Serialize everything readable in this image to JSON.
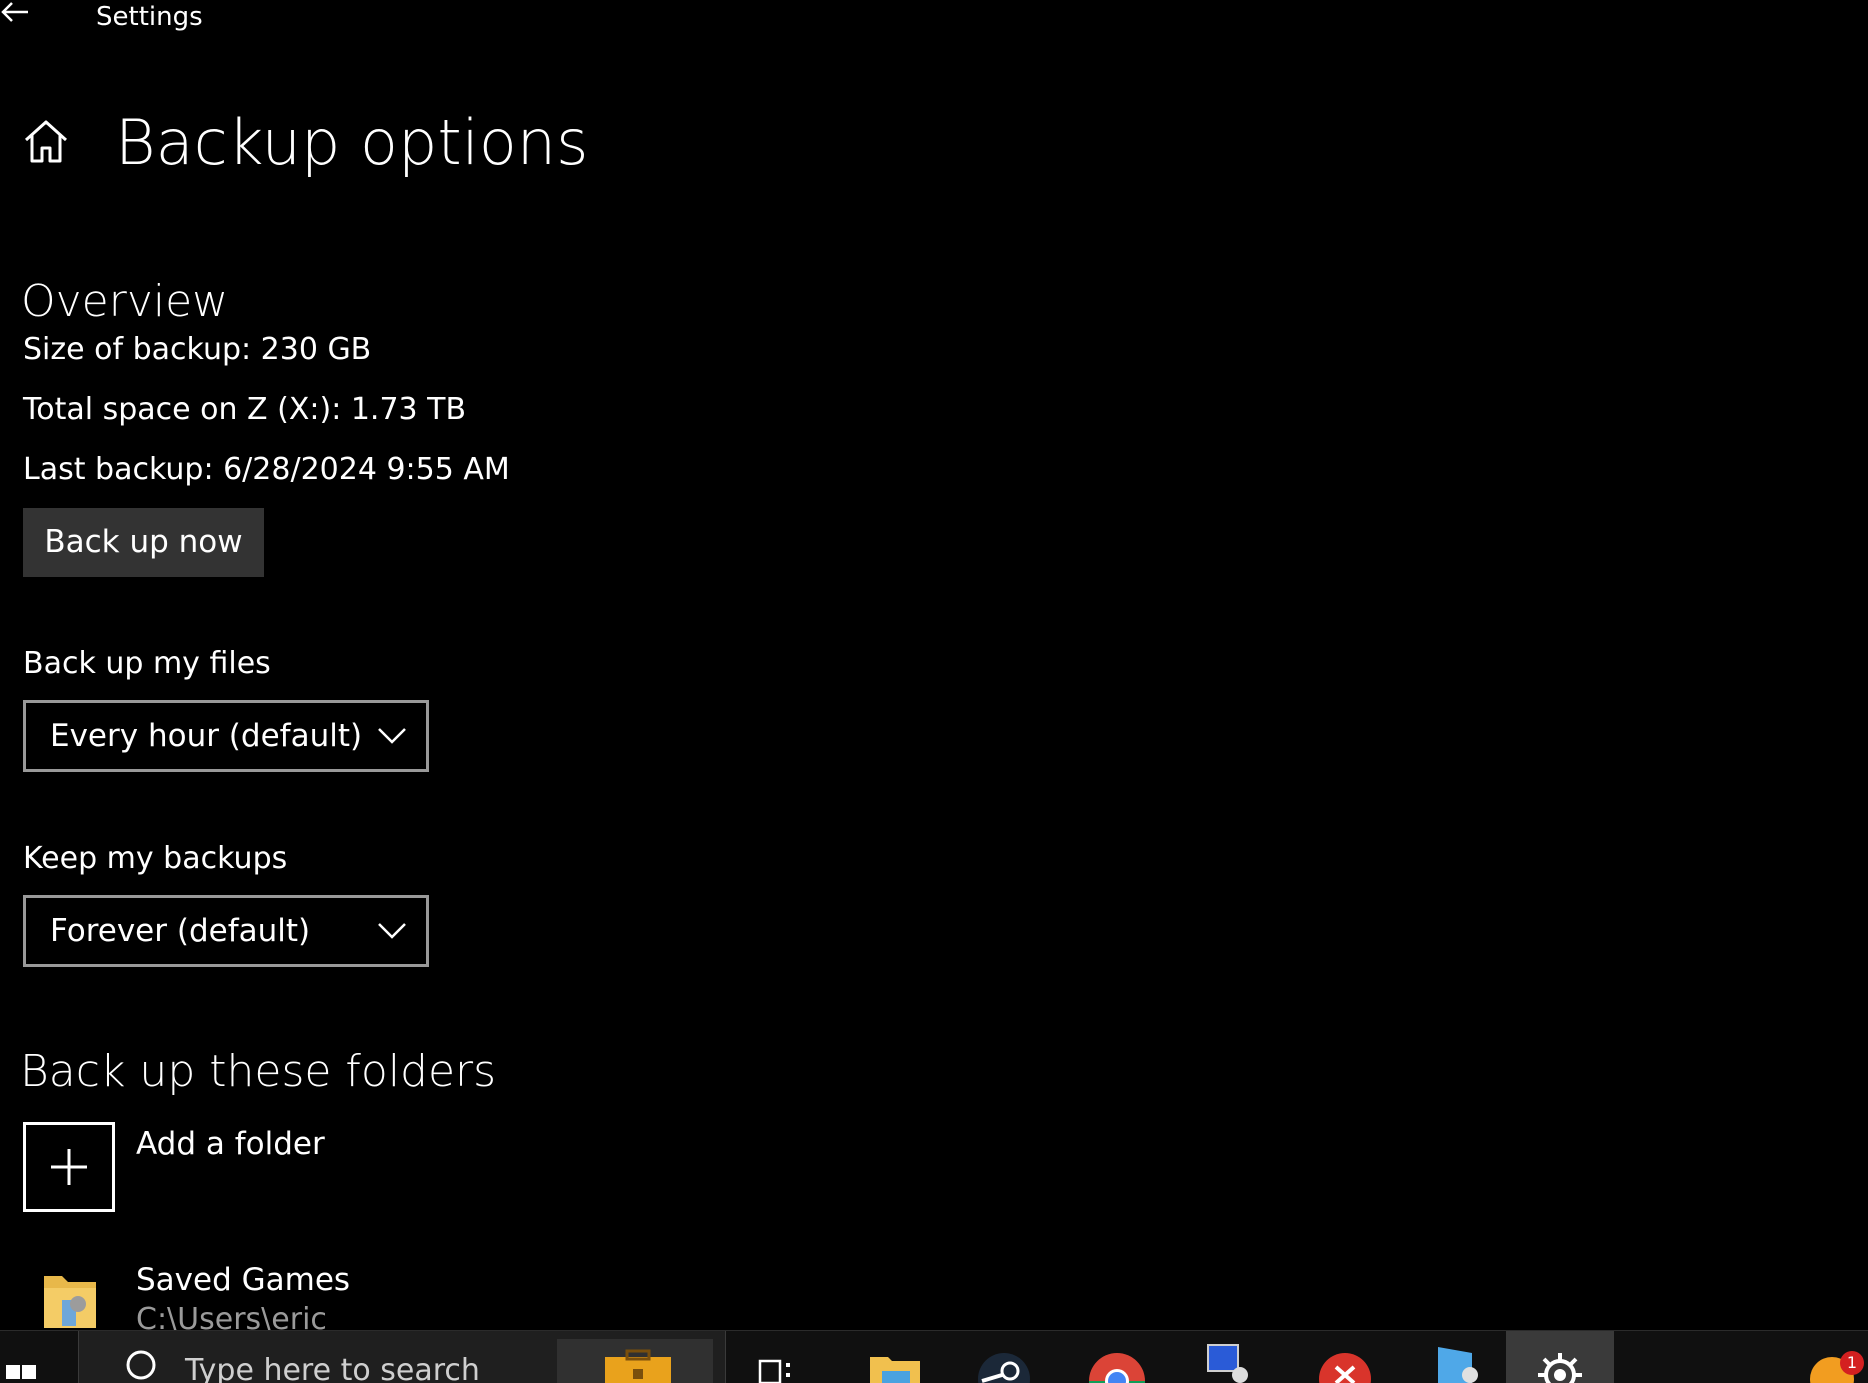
{
  "window": {
    "title": "Settings"
  },
  "page": {
    "title": "Backup options"
  },
  "overview": {
    "heading": "Overview",
    "size_of_backup": "Size of backup: 230 GB",
    "total_space": "Total space on Z (X:): 1.73 TB",
    "last_backup": "Last backup: 6/28/2024 9:55 AM",
    "back_up_now_label": "Back up now"
  },
  "frequency": {
    "label": "Back up my files",
    "selected": "Every hour (default)"
  },
  "retention": {
    "label": "Keep my backups",
    "selected": "Forever (default)"
  },
  "folders": {
    "heading": "Back up these folders",
    "add_label": "Add a folder",
    "items": [
      {
        "name": "Saved Games",
        "path": "C:\\Users\\eric"
      }
    ]
  },
  "taskbar": {
    "search_placeholder": "Type here to search",
    "notification_count": "1",
    "icons": [
      "windows-start-icon",
      "search-icon",
      "briefcase-icon",
      "task-view-icon",
      "file-explorer-icon",
      "steam-icon",
      "chrome-icon",
      "network-computer-icon",
      "anydesk-icon",
      "app-icon",
      "settings-icon",
      "chat-icon"
    ]
  },
  "colors": {
    "background": "#000000",
    "button": "#333333",
    "dropdown_border": "#999999",
    "taskbar": "#101010"
  }
}
